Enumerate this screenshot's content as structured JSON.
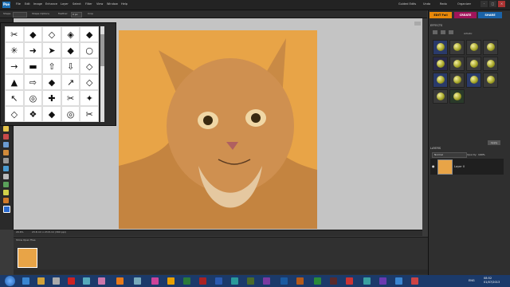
{
  "menubar": {
    "app_logo": "Pse",
    "items": [
      "File",
      "Edit",
      "Image",
      "Enhance",
      "Layer",
      "Select",
      "Filter",
      "View",
      "Window",
      "Help"
    ],
    "links": [
      "Guided Edits",
      "Undo",
      "Redo",
      "Organizer"
    ],
    "window_controls": [
      "-",
      "□",
      "×"
    ]
  },
  "options": {
    "shape_label": "Shape",
    "shape_options_label": "Shape Options",
    "feather_label": "Feather:",
    "feather_value": "0 px",
    "crop_label": "Crop"
  },
  "shapes": [
    "✂",
    "◆",
    "◇",
    "◈",
    "◆",
    "✳",
    "➜",
    "➤",
    "◆",
    "○",
    "→",
    "▬",
    "⇧",
    "⇩",
    "◇",
    "▲",
    "⇨",
    "◆",
    "↗",
    "◇",
    "↖",
    "◎",
    "✚",
    "✂",
    "✦",
    "◇",
    "❖",
    "◆",
    "◎",
    "✂"
  ],
  "status": {
    "zoom": "20.6%",
    "info": "23.8 cm x 23.8 cm (300 ppi)"
  },
  "bin": {
    "header": "Show Open Files"
  },
  "tabs": {
    "edit_full": "EDIT Full",
    "create": "CREATE",
    "share": "SHARE"
  },
  "effects": {
    "header": "EFFECTS",
    "filter_label": "Artistic",
    "apply_label": "Apply",
    "thumb_count": 14
  },
  "layers": {
    "header": "LAYERS",
    "blend_mode": "Normal",
    "opacity_label": "Opacity:",
    "opacity_value": "100%",
    "layer_name": "Layer 0"
  },
  "taskbar": {
    "tray_lang": "ENG",
    "clock_time": "08:52",
    "clock_date": "01/07/2013"
  },
  "colors": {
    "accent_edit": "#e8880a",
    "accent_create": "#a0145a",
    "accent_share": "#1b63a8",
    "image_background": "#e8a447"
  }
}
